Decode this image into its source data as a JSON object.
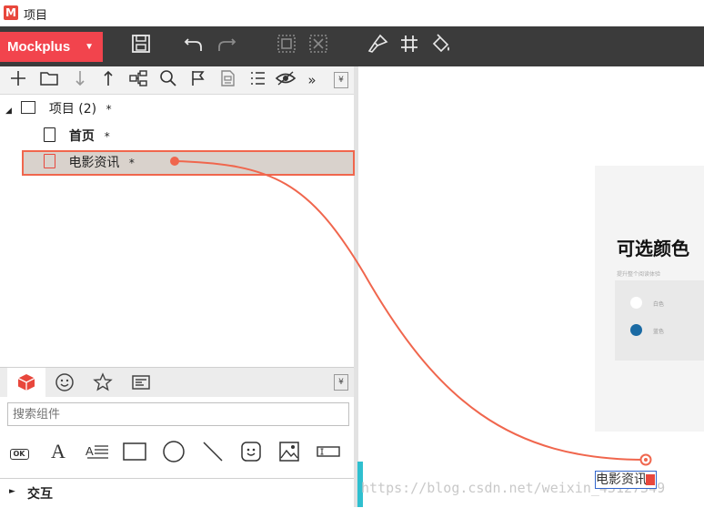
{
  "window": {
    "title": "项目",
    "app_icon": "mockplus-logo"
  },
  "toolbar": {
    "menu_label": "Mockplus",
    "menu_caret": "▼",
    "icons": [
      "save-icon",
      "undo-icon",
      "redo-icon",
      "group-icon",
      "ungroup-icon",
      "format-brush-icon",
      "grid-icon",
      "paint-bucket-icon"
    ]
  },
  "pane_toolbar": {
    "icons": [
      "add-icon",
      "folder-icon",
      "move-down-icon",
      "move-up-icon",
      "sitemap-icon",
      "search-icon",
      "flag-icon",
      "page-template-icon",
      "list-icon",
      "eye-icon",
      "more-icon"
    ],
    "more_label": "»",
    "collapse_label": "¥"
  },
  "tree": {
    "root": {
      "label": "项目 (2)",
      "mark": "*",
      "arrow": "◢"
    },
    "pages": [
      {
        "label": "首页",
        "mark": "*",
        "bold": true
      },
      {
        "label": "电影资讯",
        "mark": "*",
        "selected": true
      }
    ]
  },
  "library": {
    "tabs": [
      "cube-icon",
      "smiley-icon",
      "star-icon",
      "component-panel-icon"
    ],
    "collapse_label": "¥",
    "search_placeholder": "搜索组件",
    "components": [
      "button-icon",
      "text-icon",
      "paragraph-icon",
      "rectangle-icon",
      "circle-icon",
      "line-icon",
      "emoji-icon",
      "image-icon",
      "input-icon"
    ],
    "button_label": "OK",
    "text_label": "A"
  },
  "section": {
    "label": "交互",
    "arrow": "►"
  },
  "canvas": {
    "card_title": "可选颜色",
    "card_subtitle": "提升整个阅读体验",
    "options": [
      {
        "label": "白色",
        "color": "#ffffff"
      },
      {
        "label": "蓝色",
        "color": "#1a6aa3"
      }
    ],
    "link_label": "电影资讯"
  },
  "colors": {
    "accent": "#f2444d",
    "link_line": "#f0664d",
    "toolbar_bg": "#3b3b3b"
  },
  "watermark": "https://blog.csdn.net/weixin_43127349"
}
